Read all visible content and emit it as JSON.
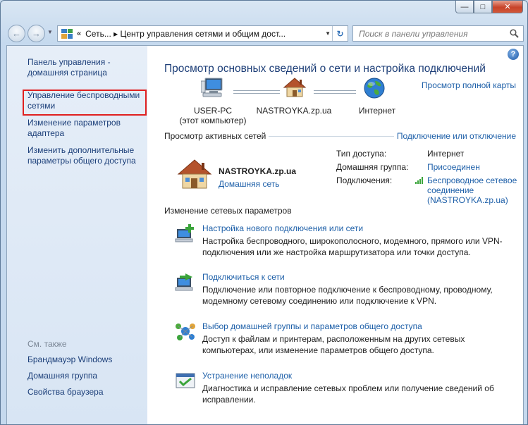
{
  "window": {
    "minimize_glyph": "—",
    "maximize_glyph": "□",
    "close_glyph": "✕"
  },
  "navbar": {
    "back_glyph": "←",
    "forward_glyph": "→",
    "address_sep": "«",
    "breadcrumb": "Сеть...  ▸  Центр управления сетями и общим дост...",
    "refresh_glyph": "↻",
    "search_placeholder": "Поиск в панели управления"
  },
  "sidebar": {
    "home_link": "Панель управления - домашняя страница",
    "wireless_link": "Управление беспроводными сетями",
    "adapter_link": "Изменение параметров адаптера",
    "sharing_link": "Изменить дополнительные параметры общего доступа",
    "see_also_heading": "См. также",
    "see_also": [
      "Брандмауэр Windows",
      "Домашняя группа",
      "Свойства браузера"
    ]
  },
  "help": {
    "glyph": "?"
  },
  "main": {
    "title": "Просмотр основных сведений о сети и настройка подключений",
    "full_map_link": "Просмотр полной карты",
    "nodes": {
      "computer_name": "USER-PC",
      "computer_sub": "(этот компьютер)",
      "network_name": "NASTROYKA.zp.ua",
      "internet_name": "Интернет"
    },
    "active_networks_heading": "Просмотр активных сетей",
    "connect_disconnect_link": "Подключение или отключение",
    "active_network": {
      "name": "NASTROYKA.zp.ua",
      "type": "Домашняя сеть",
      "access_label": "Тип доступа:",
      "access_value": "Интернет",
      "homegroup_label": "Домашняя группа:",
      "homegroup_value": "Присоединен",
      "connections_label": "Подключения:",
      "connections_line1": "Беспроводное сетевое",
      "connections_line2": "соединение",
      "connections_line3": "(NASTROYKA.zp.ua)"
    },
    "change_settings_heading": "Изменение сетевых параметров",
    "tasks": [
      {
        "link": "Настройка нового подключения или сети",
        "desc": "Настройка беспроводного, широкополосного, модемного, прямого или VPN-подключения или же настройка маршрутизатора или точки доступа."
      },
      {
        "link": "Подключиться к сети",
        "desc": "Подключение или повторное подключение к беспроводному, проводному, модемному сетевому соединению или подключение к VPN."
      },
      {
        "link": "Выбор домашней группы и параметров общего доступа",
        "desc": "Доступ к файлам и принтерам, расположенным на других сетевых компьютерах, или изменение параметров общего доступа."
      },
      {
        "link": "Устранение неполадок",
        "desc": "Диагностика и исправление сетевых проблем или получение сведений об исправлении."
      }
    ]
  },
  "colors": {
    "link": "#1d5fa8",
    "title": "#1e3f78",
    "highlight": "#e02020"
  }
}
